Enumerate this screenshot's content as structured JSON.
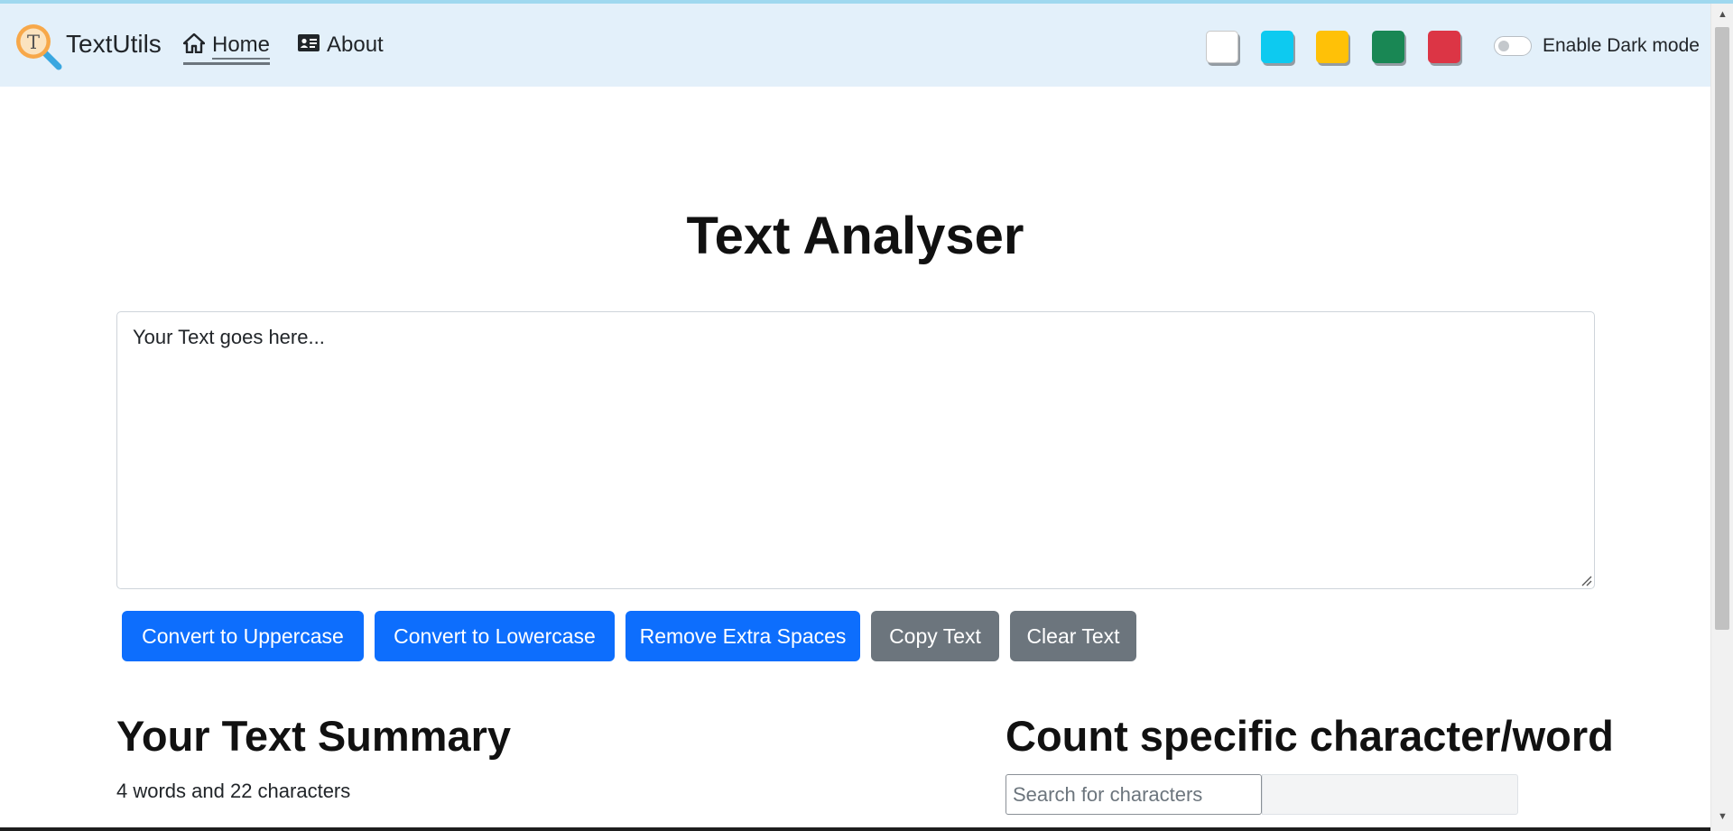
{
  "navbar": {
    "brand": "TextUtils",
    "logo_letter": "T",
    "links": [
      {
        "label": "Home",
        "icon": "home-icon",
        "active": true
      },
      {
        "label": "About",
        "icon": "id-card-icon",
        "active": false
      }
    ],
    "color_swatches": [
      "#ffffff",
      "#0dcaf0",
      "#ffc107",
      "#198754",
      "#dc3545"
    ],
    "dark_mode_label": "Enable Dark mode",
    "dark_mode_enabled": false
  },
  "main": {
    "title": "Text Analyser",
    "textarea_value": "Your Text goes here...",
    "buttons": [
      {
        "label": "Convert to Uppercase",
        "style": "primary"
      },
      {
        "label": "Convert to Lowercase",
        "style": "primary"
      },
      {
        "label": "Remove Extra Spaces",
        "style": "primary"
      },
      {
        "label": "Copy Text",
        "style": "secondary"
      },
      {
        "label": "Clear Text",
        "style": "secondary"
      }
    ]
  },
  "summary": {
    "title": "Your Text Summary",
    "stats": "4 words and 22 characters"
  },
  "count": {
    "title": "Count specific character/word",
    "search_placeholder": "Search for characters",
    "result_value": ""
  },
  "colors": {
    "navbar_bg": "#e3f0fa",
    "primary": "#0d6efd",
    "secondary": "#6c757d"
  }
}
